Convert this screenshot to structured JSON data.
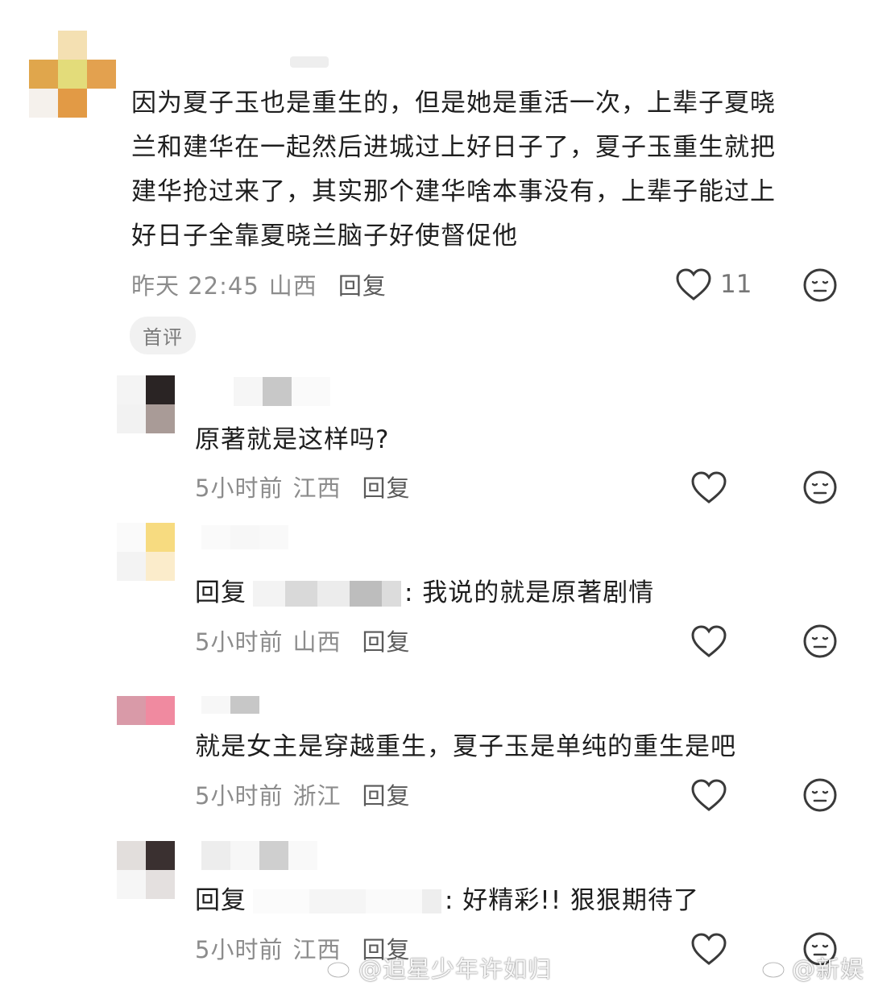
{
  "main_comment": {
    "text_lines": [
      "因为夏子玉也是重生的，但是她是重活一次，上辈子夏晓",
      "兰和建华在一起然后进城过上好日子了，夏子玉重生就把",
      "建华抢过来了，其实那个建华啥本事没有，上辈子能过上",
      "好日子全靠夏晓兰脑子好使督促他"
    ],
    "time": "昨天 22:45",
    "region": "山西",
    "reply_label": "回复",
    "likes": "11",
    "badge": "首评"
  },
  "replies": [
    {
      "text": "原著就是这样吗?",
      "time": "5小时前",
      "region": "江西",
      "reply_label": "回复"
    },
    {
      "text_prefix": "回复",
      "text": ": 我说的就是原著剧情",
      "time": "5小时前",
      "region": "山西",
      "reply_label": "回复"
    },
    {
      "text": "就是女主是穿越重生，夏子玉是单纯的重生是吧",
      "time": "5小时前",
      "region": "浙江",
      "reply_label": "回复"
    },
    {
      "text_prefix": "回复",
      "text": ": 好精彩!! 狠狠期待了",
      "time": "5小时前",
      "region": "江西",
      "reply_label": "回复"
    }
  ],
  "watermarks": {
    "left": "@追星少年许如归",
    "right": "@新娱"
  },
  "icons": {
    "like": "heart-outline-icon",
    "dislike": "meh-face-icon"
  },
  "colors": {
    "text": "#1e1e1e",
    "meta": "#8c8c8c",
    "icon": "#3a3a3a"
  }
}
